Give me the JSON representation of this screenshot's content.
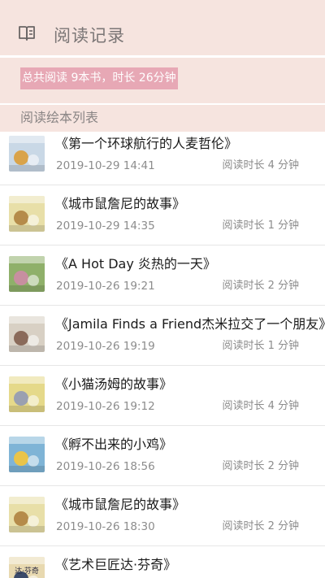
{
  "header": {
    "title": "阅读记录",
    "icon": "book-open-icon"
  },
  "summary": {
    "text": "总共阅读 9本书，时长 26分钟"
  },
  "section": {
    "label": "阅读绘本列表"
  },
  "books": [
    {
      "title": "《第一个环球航行的人麦哲伦》",
      "date": "2019-10-29 14:41",
      "duration": "阅读时长 4 分钟",
      "cover_color": "#c9d8e6",
      "cover_accent": "#d9a34a"
    },
    {
      "title": "《城市鼠詹尼的故事》",
      "date": "2019-10-29 14:35",
      "duration": "阅读时长 1 分钟",
      "cover_color": "#e8dfa8",
      "cover_accent": "#b58b4a"
    },
    {
      "title": "《A Hot Day  炎热的一天》",
      "date": "2019-10-26 19:21",
      "duration": "阅读时长 2 分钟",
      "cover_color": "#8fb06a",
      "cover_accent": "#c78fa0"
    },
    {
      "title": "《Jamila Finds a Friend杰米拉交了一个朋友》",
      "date": "2019-10-26 19:19",
      "duration": "阅读时长 1 分钟",
      "cover_color": "#d8d0c4",
      "cover_accent": "#8a6a5a"
    },
    {
      "title": "《小猫汤姆的故事》",
      "date": "2019-10-26 19:12",
      "duration": "阅读时长 4 分钟",
      "cover_color": "#e5d98a",
      "cover_accent": "#9aa0b0"
    },
    {
      "title": "《孵不出来的小鸡》",
      "date": "2019-10-26 18:56",
      "duration": "阅读时长 2 分钟",
      "cover_color": "#7fb4d6",
      "cover_accent": "#e9c44a"
    },
    {
      "title": "《城市鼠詹尼的故事》",
      "date": "2019-10-26 18:30",
      "duration": "阅读时长 2 分钟",
      "cover_color": "#e8dfa8",
      "cover_accent": "#b58b4a"
    },
    {
      "title": "《艺术巨匠达·芬奇》",
      "date": "",
      "duration": "",
      "cover_color": "#e8d9b0",
      "cover_accent": "#3a4a6a",
      "cover_text": "达·芬奇"
    }
  ]
}
